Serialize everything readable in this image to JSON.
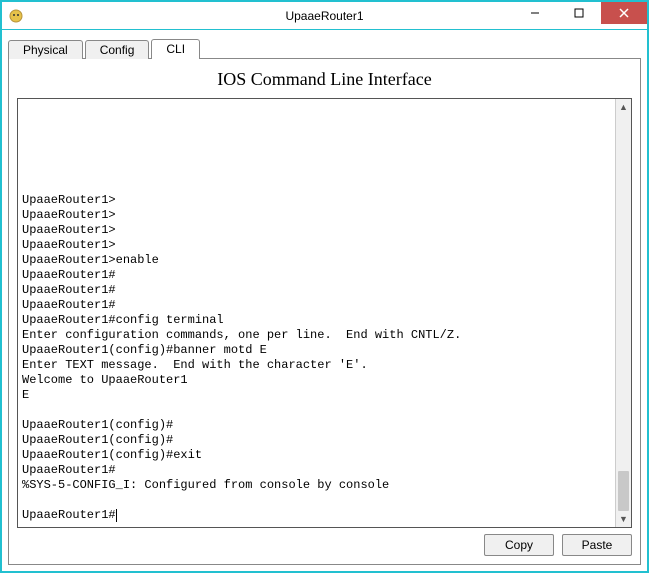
{
  "window": {
    "title": "UpaaeRouter1"
  },
  "tabs": {
    "physical": "Physical",
    "config": "Config",
    "cli": "CLI"
  },
  "panel": {
    "title": "IOS Command Line Interface"
  },
  "terminal": {
    "lines": [
      "UpaaeRouter1>",
      "UpaaeRouter1>",
      "UpaaeRouter1>",
      "UpaaeRouter1>",
      "UpaaeRouter1>enable",
      "UpaaeRouter1#",
      "UpaaeRouter1#",
      "UpaaeRouter1#",
      "UpaaeRouter1#config terminal",
      "Enter configuration commands, one per line.  End with CNTL/Z.",
      "UpaaeRouter1(config)#banner motd E",
      "Enter TEXT message.  End with the character 'E'.",
      "Welcome to UpaaeRouter1",
      "E",
      "",
      "UpaaeRouter1(config)#",
      "UpaaeRouter1(config)#",
      "UpaaeRouter1(config)#exit",
      "UpaaeRouter1#",
      "%SYS-5-CONFIG_I: Configured from console by console",
      ""
    ],
    "prompt": "UpaaeRouter1#"
  },
  "buttons": {
    "copy": "Copy",
    "paste": "Paste"
  }
}
